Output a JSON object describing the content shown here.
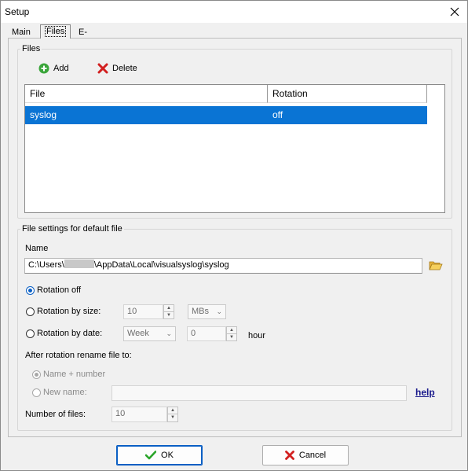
{
  "window": {
    "title": "Setup"
  },
  "tabs": [
    {
      "label": "Main",
      "active": false
    },
    {
      "label": "Files",
      "active": true
    },
    {
      "label": "E-mail",
      "active": false
    }
  ],
  "files_group": {
    "legend": "Files",
    "add_label": "Add",
    "delete_label": "Delete",
    "columns": [
      "File",
      "Rotation"
    ],
    "rows": [
      {
        "file": "syslog",
        "rotation": "off",
        "selected": true
      }
    ]
  },
  "settings_group": {
    "legend": "File settings for default file",
    "name_label": "Name",
    "path_prefix": "C:\\Users\\",
    "path_suffix": "\\AppData\\Local\\visualsyslog\\syslog",
    "rotation_off_label": "Rotation off",
    "rotation_size_label": "Rotation by size:",
    "rotation_size_value": "10",
    "size_unit": "MBs",
    "rotation_date_label": "Rotation by date:",
    "date_period": "Week",
    "date_hour_value": "0",
    "hour_label": "hour",
    "rename_label": "After rotation rename file to:",
    "name_number_label": "Name + number",
    "new_name_label": "New name:",
    "new_name_value": "",
    "help_label": "help",
    "number_of_files_label": "Number of files:",
    "number_of_files_value": "10",
    "selected_rotation": "off"
  },
  "buttons": {
    "ok_label": "OK",
    "cancel_label": "Cancel"
  },
  "colors": {
    "selection": "#0a74d4",
    "ok_check": "#2aa52a",
    "cancel_x": "#d22020",
    "add_icon": "#3aa53a",
    "delete_icon": "#d22020"
  }
}
